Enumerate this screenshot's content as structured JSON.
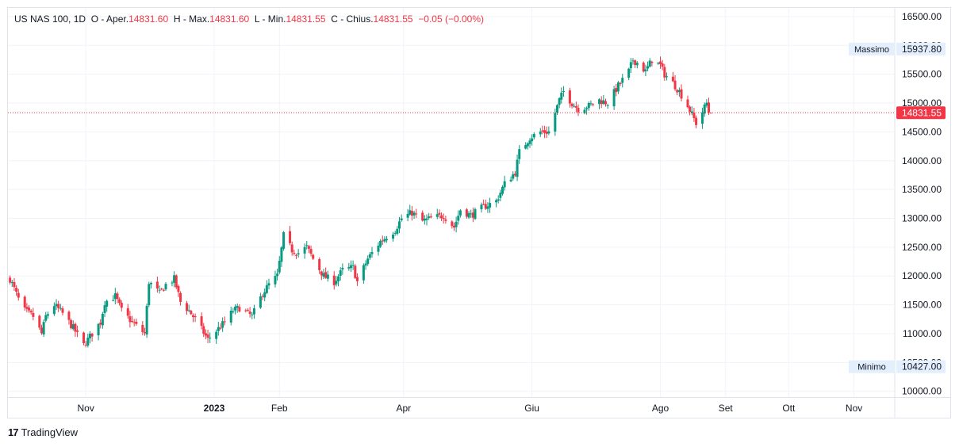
{
  "legend": {
    "symbol": "US NAS 100, 1D",
    "open_label": "O - Aper.",
    "open": "14831.60",
    "high_label": "H - Max.",
    "high": "14831.60",
    "low_label": "L - Min.",
    "low": "14831.55",
    "close_label": "C - Chius.",
    "close": "14831.55",
    "change": "−0.05 (−0.00%)"
  },
  "branding": {
    "logo": "17",
    "name": "TradingView"
  },
  "colors": {
    "up": "#089981",
    "down": "#f23645",
    "grid": "#f0f3fa",
    "axis_text": "#131722",
    "label_bg": "#e3effd"
  },
  "chart_data": {
    "type": "candlestick",
    "y_axis": {
      "ylim": [
        9900,
        16650
      ],
      "ticks": [
        10000,
        10500,
        11000,
        11500,
        12000,
        12500,
        13000,
        13500,
        14000,
        14500,
        15000,
        15500,
        16000,
        16500
      ],
      "tick_labels": [
        "10000.00",
        "10500.00",
        "11000.00",
        "11500.00",
        "12000.00",
        "12500.00",
        "13000.00",
        "13500.00",
        "14000.00",
        "14500.00",
        "15000.00",
        "15500.00",
        "16000.00",
        "16500.00"
      ]
    },
    "x_axis": {
      "range": [
        "2022-09-25",
        "2023-11-20"
      ],
      "tick_dates": [
        "2022-11-01",
        "2023-01-01",
        "2023-02-01",
        "2023-04-01",
        "2023-06-01",
        "2023-08-01",
        "2023-09-01",
        "2023-10-01",
        "2023-11-01"
      ],
      "tick_labels": [
        "Nov",
        "2023",
        "Feb",
        "Apr",
        "Giu",
        "Ago",
        "Set",
        "Ott",
        "Nov"
      ]
    },
    "price_labels": [
      {
        "label": "Massimo",
        "value": 15937.8,
        "value_text": "15937.80"
      },
      {
        "label": "Minimo",
        "value": 10427.0,
        "value_text": "10427.00"
      },
      {
        "label": "",
        "value": 14831.55,
        "value_text": "14831.55",
        "current": true
      }
    ],
    "anchors": [
      [
        "2022-09-26",
        11950
      ],
      [
        "2022-09-30",
        11600
      ],
      [
        "2022-10-03",
        11400
      ],
      [
        "2022-10-07",
        11300
      ],
      [
        "2022-10-11",
        11000
      ],
      [
        "2022-10-13",
        11300
      ],
      [
        "2022-10-17",
        11500
      ],
      [
        "2022-10-21",
        11350
      ],
      [
        "2022-10-26",
        11100
      ],
      [
        "2022-10-31",
        10800
      ],
      [
        "2022-11-04",
        11000
      ],
      [
        "2022-11-08",
        11200
      ],
      [
        "2022-11-10",
        11550
      ],
      [
        "2022-11-15",
        11650
      ],
      [
        "2022-11-18",
        11400
      ],
      [
        "2022-11-23",
        11200
      ],
      [
        "2022-11-29",
        11000
      ],
      [
        "2022-12-01",
        11900
      ],
      [
        "2022-12-06",
        11700
      ],
      [
        "2022-12-09",
        11850
      ],
      [
        "2022-12-13",
        11950
      ],
      [
        "2022-12-16",
        11550
      ],
      [
        "2022-12-20",
        11400
      ],
      [
        "2022-12-23",
        11250
      ],
      [
        "2022-12-29",
        10900
      ],
      [
        "2023-01-06",
        11200
      ],
      [
        "2023-01-10",
        11400
      ],
      [
        "2023-01-13",
        11450
      ],
      [
        "2023-01-19",
        11300
      ],
      [
        "2023-01-24",
        11700
      ],
      [
        "2023-01-27",
        11850
      ],
      [
        "2023-01-31",
        12000
      ],
      [
        "2023-02-03",
        12700
      ],
      [
        "2023-02-07",
        12450
      ],
      [
        "2023-02-10",
        12400
      ],
      [
        "2023-02-14",
        12500
      ],
      [
        "2023-02-17",
        12300
      ],
      [
        "2023-02-22",
        12000
      ],
      [
        "2023-02-27",
        11900
      ],
      [
        "2023-03-03",
        12100
      ],
      [
        "2023-03-08",
        12150
      ],
      [
        "2023-03-10",
        11900
      ],
      [
        "2023-03-15",
        12300
      ],
      [
        "2023-03-21",
        12600
      ],
      [
        "2023-03-28",
        12800
      ],
      [
        "2023-03-31",
        13000
      ],
      [
        "2023-04-05",
        13100
      ],
      [
        "2023-04-10",
        12950
      ],
      [
        "2023-04-14",
        13000
      ],
      [
        "2023-04-20",
        13050
      ],
      [
        "2023-04-25",
        12850
      ],
      [
        "2023-04-28",
        13150
      ],
      [
        "2023-05-03",
        13050
      ],
      [
        "2023-05-09",
        13200
      ],
      [
        "2023-05-15",
        13300
      ],
      [
        "2023-05-19",
        13600
      ],
      [
        "2023-05-24",
        13800
      ],
      [
        "2023-05-26",
        14150
      ],
      [
        "2023-05-31",
        14400
      ],
      [
        "2023-06-05",
        14500
      ],
      [
        "2023-06-09",
        14500
      ],
      [
        "2023-06-14",
        15050
      ],
      [
        "2023-06-16",
        15200
      ],
      [
        "2023-06-20",
        15000
      ],
      [
        "2023-06-23",
        14900
      ],
      [
        "2023-06-28",
        14950
      ],
      [
        "2023-07-03",
        15050
      ],
      [
        "2023-07-07",
        15000
      ],
      [
        "2023-07-12",
        15300
      ],
      [
        "2023-07-17",
        15550
      ],
      [
        "2023-07-19",
        15750
      ],
      [
        "2023-07-21",
        15700
      ],
      [
        "2023-07-25",
        15550
      ],
      [
        "2023-07-28",
        15750
      ],
      [
        "2023-08-01",
        15650
      ],
      [
        "2023-08-03",
        15500
      ],
      [
        "2023-08-07",
        15350
      ],
      [
        "2023-08-10",
        15200
      ],
      [
        "2023-08-14",
        14950
      ],
      [
        "2023-08-16",
        14800
      ],
      [
        "2023-08-18",
        14650
      ],
      [
        "2023-08-21",
        14850
      ],
      [
        "2023-08-23",
        15000
      ],
      [
        "2023-08-24",
        14850
      ],
      [
        "2023-08-25",
        14831.55
      ]
    ]
  }
}
